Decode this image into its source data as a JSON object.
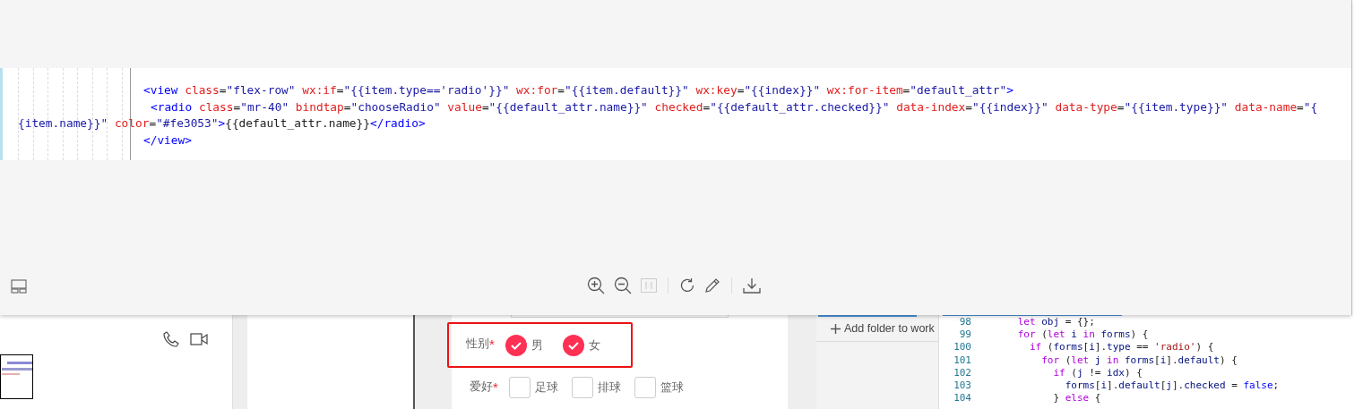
{
  "image_viewer": {
    "code_lines": [
      {
        "kind": "nested",
        "tokens": [
          {
            "text": "<view",
            "kind": "tag"
          },
          {
            "text": " class",
            "kind": "attr"
          },
          {
            "text": "=",
            "kind": "punct"
          },
          {
            "text": "\"flex-row\"",
            "kind": "string"
          },
          {
            "text": " wx:if",
            "kind": "attr"
          },
          {
            "text": "=",
            "kind": "punct"
          },
          {
            "text": "\"{{item.type=='radio'}}\"",
            "kind": "string"
          },
          {
            "text": " wx:for",
            "kind": "attr"
          },
          {
            "text": "=",
            "kind": "punct"
          },
          {
            "text": "\"{{item.default}}\"",
            "kind": "string"
          },
          {
            "text": " wx:key",
            "kind": "attr"
          },
          {
            "text": "=",
            "kind": "punct"
          },
          {
            "text": "\"{{index}}\"",
            "kind": "string"
          },
          {
            "text": " wx:for-item",
            "kind": "attr"
          },
          {
            "text": "=",
            "kind": "punct"
          },
          {
            "text": "\"default_attr\"",
            "kind": "string"
          },
          {
            "text": ">",
            "kind": "tag"
          }
        ]
      },
      {
        "kind": "deeper",
        "tokens": [
          {
            "text": "<radio",
            "kind": "tag"
          },
          {
            "text": " class",
            "kind": "attr"
          },
          {
            "text": "=",
            "kind": "punct"
          },
          {
            "text": "\"mr-40\"",
            "kind": "string"
          },
          {
            "text": " bindtap",
            "kind": "attr"
          },
          {
            "text": "=",
            "kind": "punct"
          },
          {
            "text": "\"chooseRadio\"",
            "kind": "string"
          },
          {
            "text": " value",
            "kind": "attr"
          },
          {
            "text": "=",
            "kind": "punct"
          },
          {
            "text": "\"{{default_attr.name}}\"",
            "kind": "string"
          },
          {
            "text": " checked",
            "kind": "attr"
          },
          {
            "text": "=",
            "kind": "punct"
          },
          {
            "text": "\"{{default_attr.checked}}\"",
            "kind": "string"
          },
          {
            "text": " data-index",
            "kind": "attr"
          },
          {
            "text": "=",
            "kind": "punct"
          },
          {
            "text": "\"{{index}}\"",
            "kind": "string"
          },
          {
            "text": " data-type",
            "kind": "attr"
          },
          {
            "text": "=",
            "kind": "punct"
          },
          {
            "text": "\"{{item.type}}\"",
            "kind": "string"
          },
          {
            "text": " data-name",
            "kind": "attr"
          },
          {
            "text": "=",
            "kind": "punct"
          },
          {
            "text": "\"{",
            "kind": "string"
          }
        ]
      },
      {
        "kind": "wrapped",
        "tokens": [
          {
            "text": "{item.name}}\"",
            "kind": "string"
          },
          {
            "text": " color",
            "kind": "attr"
          },
          {
            "text": "=",
            "kind": "punct"
          },
          {
            "text": "\"#fe3053\"",
            "kind": "string"
          },
          {
            "text": ">",
            "kind": "tag"
          },
          {
            "text": "{{default_attr.name}}",
            "kind": "text"
          },
          {
            "text": "</radio>",
            "kind": "tag"
          }
        ]
      },
      {
        "kind": "nested",
        "tokens": [
          {
            "text": "</view>",
            "kind": "tag"
          }
        ]
      }
    ]
  },
  "form": {
    "rows": [
      {
        "label": "性别",
        "required": "*",
        "kind": "radio",
        "options": [
          {
            "label": "男",
            "selected": true
          },
          {
            "label": "女",
            "selected": true
          }
        ]
      },
      {
        "label": "爱好",
        "required": "*",
        "kind": "checkbox",
        "options": [
          {
            "label": "足球",
            "checked": false
          },
          {
            "label": "排球",
            "checked": false
          },
          {
            "label": "篮球",
            "checked": false
          }
        ]
      }
    ]
  },
  "explorer": {
    "action": "Add folder to work"
  },
  "editor": {
    "lines": [
      {
        "number": "98",
        "tokens": [
          {
            "text": "      let",
            "kind": "keyword"
          },
          {
            "text": " obj",
            "kind": "ident"
          },
          {
            "text": " = {};",
            "kind": "punct"
          }
        ]
      },
      {
        "number": "99",
        "tokens": [
          {
            "text": "      for",
            "kind": "keyword"
          },
          {
            "text": " (",
            "kind": "punct"
          },
          {
            "text": "let",
            "kind": "keyword"
          },
          {
            "text": " i ",
            "kind": "ident"
          },
          {
            "text": "in",
            "kind": "keyword"
          },
          {
            "text": " forms",
            "kind": "ident"
          },
          {
            "text": ") {",
            "kind": "punct"
          }
        ]
      },
      {
        "number": "100",
        "tokens": [
          {
            "text": "        if",
            "kind": "keyword"
          },
          {
            "text": " (",
            "kind": "punct"
          },
          {
            "text": "forms",
            "kind": "ident"
          },
          {
            "text": "[",
            "kind": "punct"
          },
          {
            "text": "i",
            "kind": "ident"
          },
          {
            "text": "].",
            "kind": "punct"
          },
          {
            "text": "type",
            "kind": "ident"
          },
          {
            "text": " == ",
            "kind": "punct"
          },
          {
            "text": "'radio'",
            "kind": "string"
          },
          {
            "text": ") {",
            "kind": "punct"
          }
        ]
      },
      {
        "number": "101",
        "tokens": [
          {
            "text": "          for",
            "kind": "keyword"
          },
          {
            "text": " (",
            "kind": "punct"
          },
          {
            "text": "let",
            "kind": "keyword"
          },
          {
            "text": " j ",
            "kind": "ident"
          },
          {
            "text": "in",
            "kind": "keyword"
          },
          {
            "text": " forms",
            "kind": "ident"
          },
          {
            "text": "[",
            "kind": "punct"
          },
          {
            "text": "i",
            "kind": "ident"
          },
          {
            "text": "].",
            "kind": "punct"
          },
          {
            "text": "default",
            "kind": "ident"
          },
          {
            "text": ") {",
            "kind": "punct"
          }
        ]
      },
      {
        "number": "102",
        "tokens": [
          {
            "text": "            if",
            "kind": "keyword"
          },
          {
            "text": " (",
            "kind": "punct"
          },
          {
            "text": "j",
            "kind": "ident"
          },
          {
            "text": " != ",
            "kind": "punct"
          },
          {
            "text": "idx",
            "kind": "ident"
          },
          {
            "text": ") {",
            "kind": "punct"
          }
        ]
      },
      {
        "number": "103",
        "tokens": [
          {
            "text": "              forms",
            "kind": "ident"
          },
          {
            "text": "[",
            "kind": "punct"
          },
          {
            "text": "i",
            "kind": "ident"
          },
          {
            "text": "].",
            "kind": "punct"
          },
          {
            "text": "default",
            "kind": "ident"
          },
          {
            "text": "[",
            "kind": "punct"
          },
          {
            "text": "j",
            "kind": "ident"
          },
          {
            "text": "].",
            "kind": "punct"
          },
          {
            "text": "checked",
            "kind": "ident"
          },
          {
            "text": " = ",
            "kind": "punct"
          },
          {
            "text": "false",
            "kind": "literal"
          },
          {
            "text": ";",
            "kind": "punct"
          }
        ]
      },
      {
        "number": "104",
        "tokens": [
          {
            "text": "            } ",
            "kind": "punct"
          },
          {
            "text": "else",
            "kind": "keyword"
          },
          {
            "text": " {",
            "kind": "punct"
          }
        ]
      }
    ]
  }
}
